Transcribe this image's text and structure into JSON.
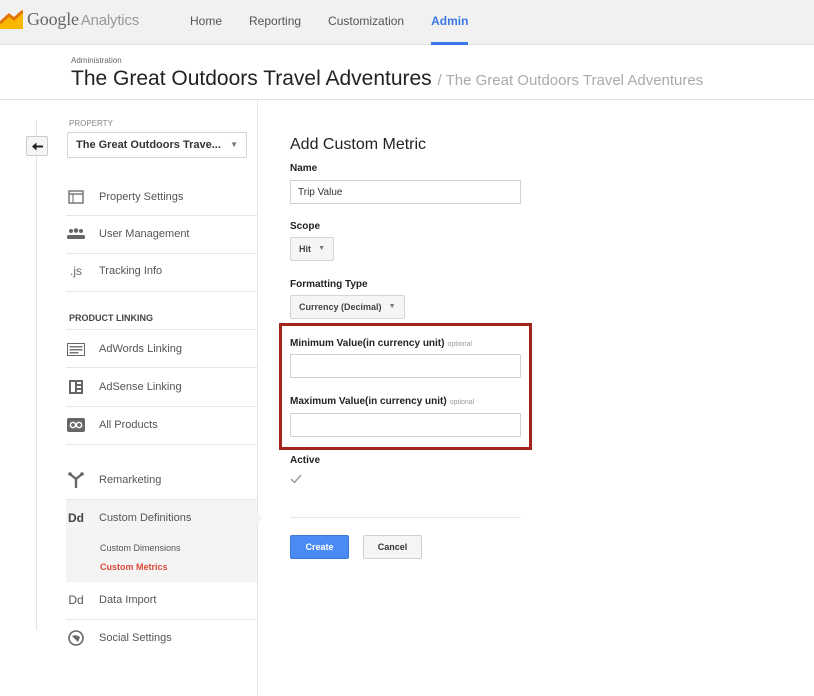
{
  "app": {
    "logo_word": "Google",
    "logo_product": "Analytics"
  },
  "nav": {
    "items": [
      "Home",
      "Reporting",
      "Customization",
      "Admin"
    ],
    "active": "Admin"
  },
  "header": {
    "admin_label": "Administration",
    "account_name": "The Great Outdoors Travel Adventures",
    "property_name": "/ The Great Outdoors Travel Adventures"
  },
  "sidebar": {
    "property_caption": "PROPERTY",
    "property_value": "The Great Outdoors Trave...",
    "items": [
      {
        "label": "Property Settings",
        "icon": "window-icon"
      },
      {
        "label": "User Management",
        "icon": "users-icon"
      },
      {
        "label": "Tracking Info",
        "icon": "js-icon",
        "icon_text": ".js"
      }
    ],
    "product_linking_caption": "PRODUCT LINKING",
    "linking_items": [
      {
        "label": "AdWords Linking",
        "icon": "adwords-icon"
      },
      {
        "label": "AdSense Linking",
        "icon": "adsense-icon"
      },
      {
        "label": "All Products",
        "icon": "all-products-icon"
      }
    ],
    "remarketing": {
      "label": "Remarketing",
      "icon": "remarketing-icon"
    },
    "custom_definitions": {
      "label": "Custom Definitions",
      "icon_text": "Dd",
      "sub_items": [
        "Custom Dimensions",
        "Custom Metrics"
      ],
      "active_sub": "Custom Metrics"
    },
    "data_import": {
      "label": "Data Import",
      "icon_text": "Dd"
    },
    "social_settings": {
      "label": "Social Settings",
      "icon": "social-icon"
    }
  },
  "form": {
    "title": "Add Custom Metric",
    "name_label": "Name",
    "name_value": "Trip Value",
    "scope_label": "Scope",
    "scope_value": "Hit",
    "formatting_label": "Formatting Type",
    "formatting_value": "Currency (Decimal)",
    "min_label": "Minimum Value(in currency unit)",
    "min_optional": "optional",
    "min_value": "",
    "max_label": "Maximum Value(in currency unit)",
    "max_optional": "optional",
    "max_value": "",
    "active_label": "Active",
    "active_checked": true,
    "create_label": "Create",
    "cancel_label": "Cancel"
  },
  "colors": {
    "accent": "#3b78e7",
    "create_button": "#4a8af4",
    "highlight_box": "#a3241b",
    "active_sub_link": "#dd4b39"
  }
}
